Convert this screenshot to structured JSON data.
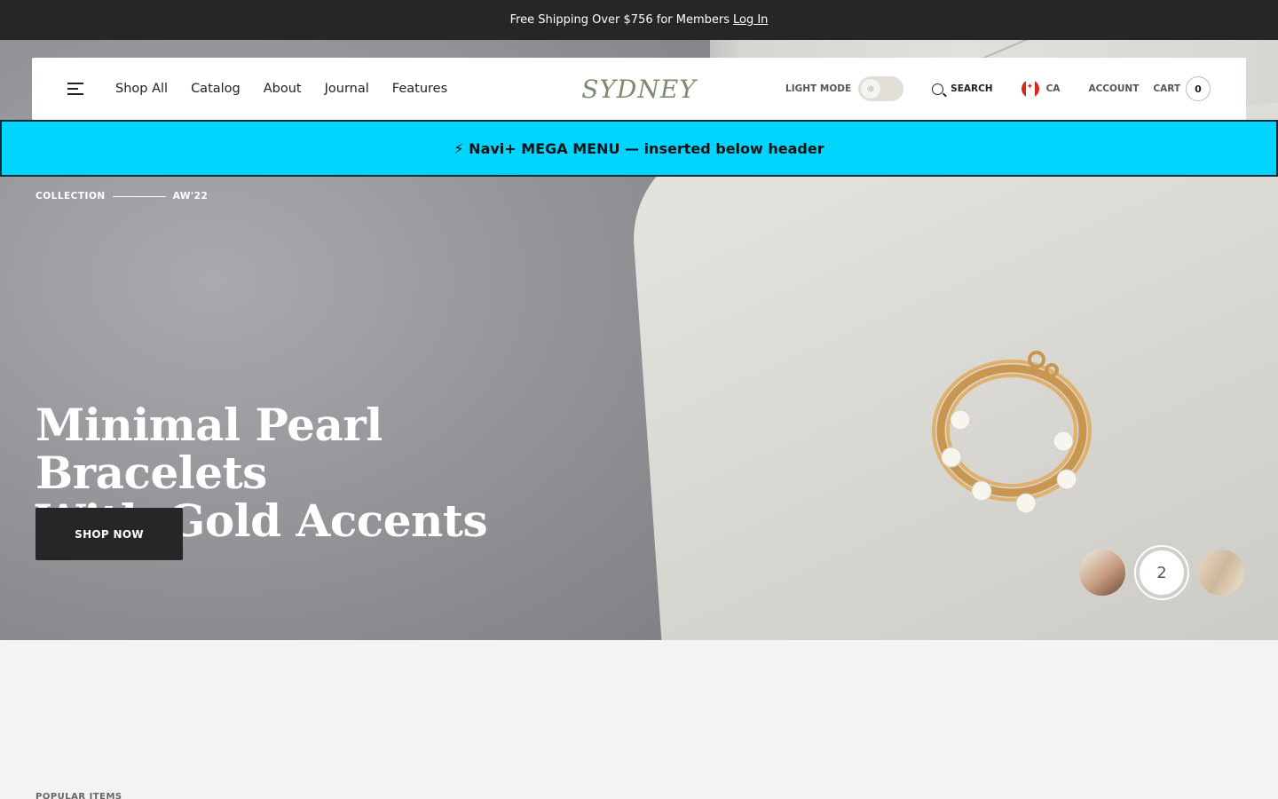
{
  "announcement": {
    "text": "Free Shipping Over $756 for Members",
    "link": "Log In"
  },
  "header": {
    "nav": [
      "Shop All",
      "Catalog",
      "About",
      "Journal",
      "Features"
    ],
    "logo": "SYDNEY",
    "mode_label": "LIGHT MODE",
    "search_label": "SEARCH",
    "country": "CA",
    "account_label": "ACCOUNT",
    "cart_label": "CART",
    "cart_count": "0"
  },
  "mega_banner": "⚡ Navi+ MEGA MENU — inserted below header",
  "hero": {
    "collection_label": "COLLECTION",
    "collection_season": "AW'22",
    "headline_line1": "Minimal Pearl Bracelets",
    "headline_line2": "With Gold Accents",
    "cta": "SHOP NOW",
    "active_slide": "2"
  },
  "section": {
    "popular_label": "POPULAR ITEMS"
  },
  "colors": {
    "accent_logo": "#7b8b6f",
    "banner": "#00d4ff",
    "dark": "#262626"
  }
}
